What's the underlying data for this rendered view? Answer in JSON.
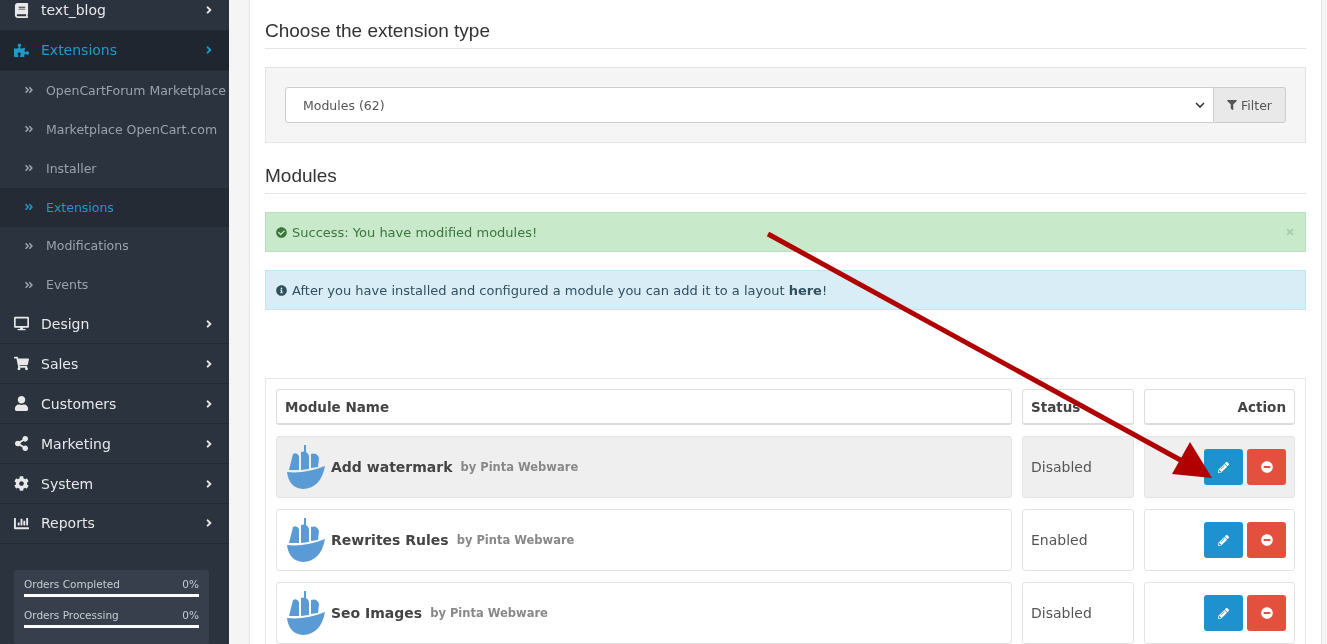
{
  "sidebar": {
    "items": [
      {
        "label": "text_blog",
        "selected": false
      },
      {
        "label": "Extensions",
        "selected": true,
        "children": [
          {
            "label": "OpenCartForum Marketplace",
            "selected": false
          },
          {
            "label": "Marketplace OpenCart.com",
            "selected": false
          },
          {
            "label": "Installer",
            "selected": false
          },
          {
            "label": "Extensions",
            "selected": true
          },
          {
            "label": "Modifications",
            "selected": false
          },
          {
            "label": "Events",
            "selected": false
          }
        ]
      },
      {
        "label": "Design",
        "selected": false
      },
      {
        "label": "Sales",
        "selected": false
      },
      {
        "label": "Customers",
        "selected": false
      },
      {
        "label": "Marketing",
        "selected": false
      },
      {
        "label": "System",
        "selected": false
      },
      {
        "label": "Reports",
        "selected": false
      }
    ],
    "stats": [
      {
        "label": "Orders Completed",
        "reading": "0%",
        "level": 0
      },
      {
        "label": "Orders Processing",
        "reading": "0%",
        "level": 0
      }
    ]
  },
  "main": {
    "heading": "Choose the extension type",
    "type_select": {
      "value": "Modules (62)"
    },
    "filter_button": "Filter",
    "section_title": "Modules",
    "alerts": [
      {
        "kind": "success",
        "text": "Success: You have modified modules!",
        "dismissible": true
      },
      {
        "kind": "info",
        "text": "After you have installed and configured a module you can add it to a layout **here**!",
        "dismissible": false
      }
    ],
    "table": {
      "columns": [
        "Module Name",
        "Status",
        "Action"
      ],
      "rows": [
        {
          "name": "Add watermark",
          "author": "by Pinta Webware",
          "status": "Disabled",
          "highlighted": true
        },
        {
          "name": "Rewrites Rules",
          "author": "by Pinta Webware",
          "status": "Enabled",
          "highlighted": false
        },
        {
          "name": "Seo Images",
          "author": "by Pinta Webware",
          "status": "Disabled",
          "highlighted": false
        }
      ]
    }
  }
}
